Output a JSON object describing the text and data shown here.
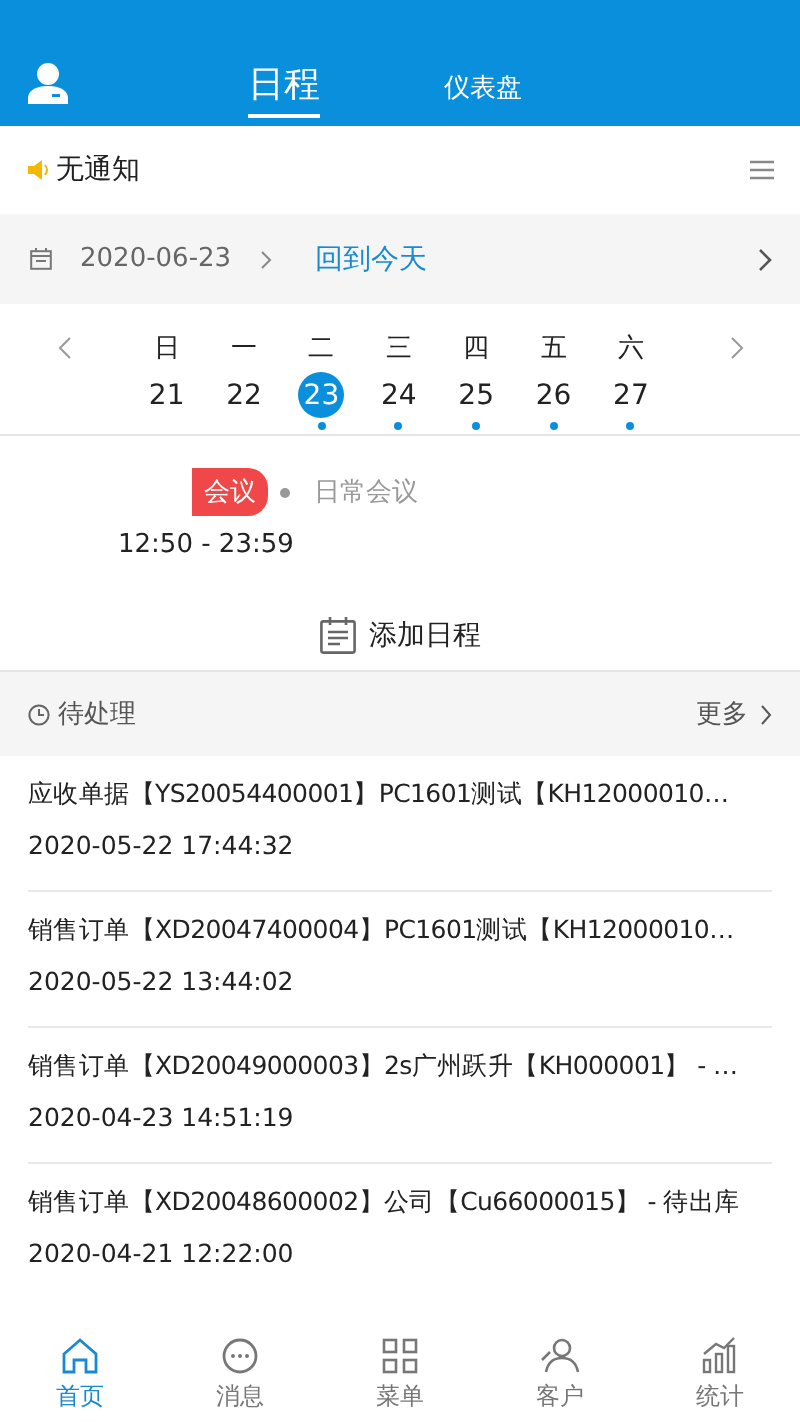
{
  "header": {
    "tabs": [
      {
        "label": "日程",
        "selected": true
      },
      {
        "label": "仪表盘",
        "selected": false
      }
    ]
  },
  "notice": {
    "text": "无通知"
  },
  "date_bar": {
    "date": "2020-06-23",
    "today_link": "回到今天"
  },
  "week": [
    {
      "weekday": "日",
      "day": "21",
      "selected": false,
      "has_event": false
    },
    {
      "weekday": "一",
      "day": "22",
      "selected": false,
      "has_event": false
    },
    {
      "weekday": "二",
      "day": "23",
      "selected": true,
      "has_event": true
    },
    {
      "weekday": "三",
      "day": "24",
      "selected": false,
      "has_event": true
    },
    {
      "weekday": "四",
      "day": "25",
      "selected": false,
      "has_event": true
    },
    {
      "weekday": "五",
      "day": "26",
      "selected": false,
      "has_event": true
    },
    {
      "weekday": "六",
      "day": "27",
      "selected": false,
      "has_event": true
    }
  ],
  "events": [
    {
      "tag": "会议",
      "color": "#f04848",
      "title": "日常会议",
      "time": "12:50 - 23:59"
    }
  ],
  "add_button": "添加日程",
  "pending": {
    "title": "待处理",
    "more": "更多",
    "items": [
      {
        "title": "应收单据【YS20054400001】PC1601测试【KH12000010…",
        "time": "2020-05-22 17:44:32"
      },
      {
        "title": "销售订单【XD20047400004】PC1601测试【KH12000010…",
        "time": "2020-05-22 13:44:02"
      },
      {
        "title": "销售订单【XD20049000003】2s广州跃升【KH000001】 - …",
        "time": "2020-04-23 14:51:19"
      },
      {
        "title": "销售订单【XD20048600002】公司【Cu66000015】 - 待出库",
        "time": "2020-04-21 12:22:00"
      }
    ]
  },
  "tab_bar": [
    {
      "label": "首页",
      "kind": "home",
      "selected": true
    },
    {
      "label": "消息",
      "kind": "chat",
      "selected": false
    },
    {
      "label": "菜单",
      "kind": "grid",
      "selected": false
    },
    {
      "label": "客户",
      "kind": "user",
      "selected": false
    },
    {
      "label": "统计",
      "kind": "stats",
      "selected": false
    }
  ]
}
